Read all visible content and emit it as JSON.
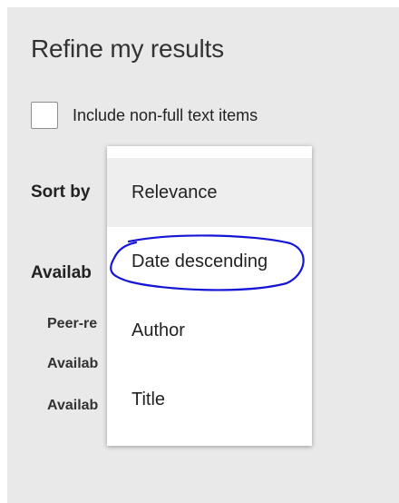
{
  "refine_panel": {
    "title": "Refine my results",
    "include_non_full_text": {
      "label": "Include non-full text items",
      "checked": false
    },
    "sort_by_label": "Sort by",
    "availability_label": "Availab",
    "filters": [
      {
        "label": "Peer-re"
      },
      {
        "label": "Availab"
      },
      {
        "label": "Availab"
      }
    ]
  },
  "sort_dropdown": {
    "options": [
      {
        "label": "Relevance",
        "highlighted": true
      },
      {
        "label": "Date descending",
        "highlighted": false
      },
      {
        "label": "Author",
        "highlighted": false
      },
      {
        "label": "Title",
        "highlighted": false
      }
    ]
  },
  "annotation": {
    "color": "#1515d6",
    "circled_option": "Date descending"
  },
  "colors": {
    "panel_background": "#e9e9e9",
    "dropdown_background": "#ffffff",
    "highlight_background": "#eeeeee",
    "text": "#222222"
  }
}
